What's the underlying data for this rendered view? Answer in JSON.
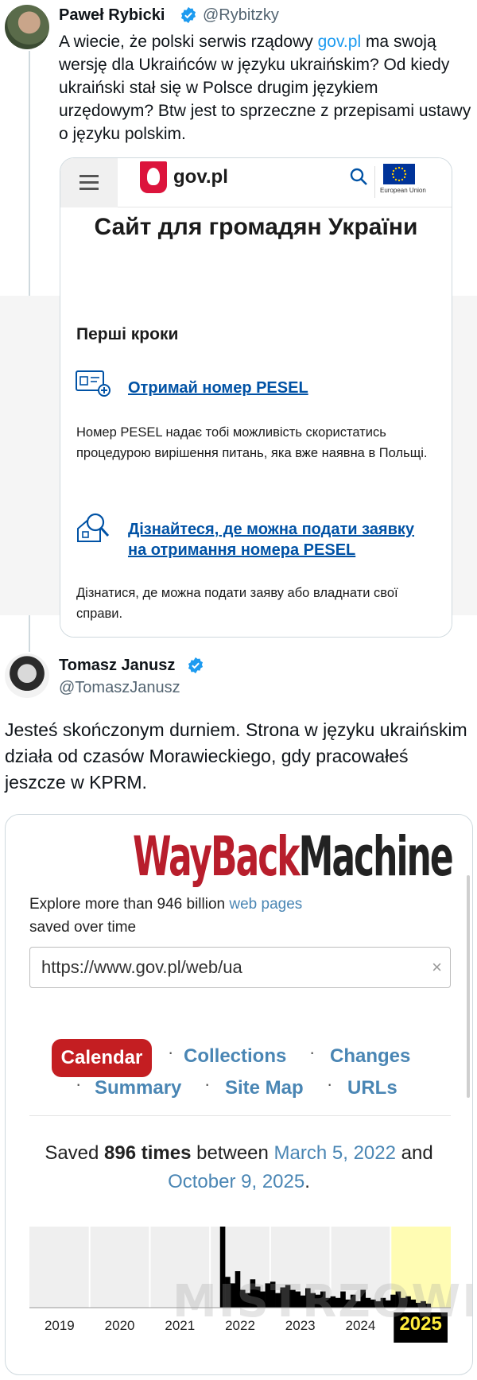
{
  "tweet1": {
    "name": "Paweł Rybicki",
    "handle": "@Rybitzky",
    "text_before_link": "A wiecie, że polski serwis rządowy ",
    "link": "gov.pl",
    "text_after_link": " ma swoją wersję dla Ukraińców w języku ukraińskim? Od kiedy ukraiński stał się w Polsce drugim językiem urzędowym? Btw jest to sprzeczne z przepisami ustawy o języku polskim."
  },
  "govpl": {
    "logo": "gov.pl",
    "eu_label": "European Union",
    "title": "Сайт для громадян України",
    "section_heading": "Перші кроки",
    "link1": "Отримай номер PESEL",
    "desc1": "Номер PESEL надає тобі можливість скористатись процедурою вирішення питань, яка вже наявна в Польщі.",
    "link2": "Дізнайтеся, де можна подати заявку на отримання номера PESEL",
    "desc2": "Дізнатися, де можна подати заяву або владнати свої справи."
  },
  "tweet2": {
    "name": "Tomasz Janusz",
    "handle": "@TomaszJanusz",
    "text": "Jesteś skończonym durniem. Strona w języku ukraińskim działa od czasów Morawieckiego, gdy pracowałeś jeszcze w KPRM."
  },
  "wayback": {
    "logo_part1": "WayBack",
    "logo_part2": "Machine",
    "explore_prefix": "Explore more than 946 billion ",
    "explore_link": "web pages",
    "explore_suffix": "saved over time",
    "url_value": "https://www.gov.pl/web/ua",
    "clear_glyph": "×",
    "nav": [
      "Calendar",
      "Collections",
      "Changes",
      "Summary",
      "Site Map",
      "URLs"
    ],
    "saved_prefix": "Saved ",
    "saved_count": "896 times",
    "saved_between": " between ",
    "saved_start": "March 5, 2022",
    "saved_and": " and",
    "saved_end": "October 9, 2025",
    "saved_period": ".",
    "watermark": "MISTRZOWIE",
    "accent": "#c41e22",
    "link_color": "#4a86b4"
  },
  "chart_data": {
    "type": "bar",
    "title": "",
    "xlabel": "",
    "ylabel": "",
    "years": [
      "2019",
      "2020",
      "2021",
      "2022",
      "2023",
      "2024",
      "2025"
    ],
    "selected_year": "2025",
    "series": [
      {
        "values": [
          0,
          0,
          0,
          0,
          0,
          0,
          0,
          0,
          0,
          0,
          0,
          0,
          0,
          0,
          0,
          0,
          0,
          0,
          0,
          0,
          0,
          0,
          0,
          0,
          0,
          0,
          0,
          0,
          0,
          0,
          0,
          0,
          0,
          0,
          0,
          0,
          0,
          0,
          100,
          38,
          30,
          45,
          22,
          18,
          35,
          26,
          20,
          30,
          32,
          18,
          25,
          28,
          22,
          20,
          15,
          24,
          18,
          16,
          20,
          12,
          14,
          12,
          20,
          10,
          16,
          8,
          22,
          12,
          10,
          8,
          12,
          9,
          16,
          20,
          12,
          14,
          10,
          6,
          8,
          5,
          0,
          0,
          0,
          0
        ]
      }
    ],
    "ylim": [
      0,
      100
    ]
  }
}
